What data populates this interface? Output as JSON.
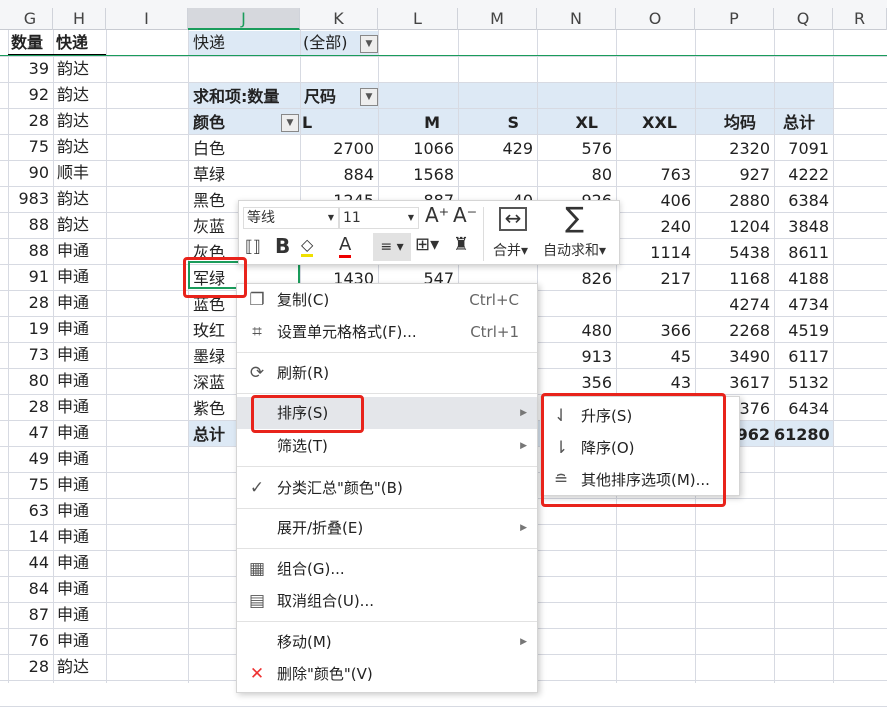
{
  "columns": [
    "G",
    "H",
    "I",
    "J",
    "K",
    "L",
    "M",
    "N",
    "O",
    "P",
    "Q",
    "R"
  ],
  "selected_column": "J",
  "source_headers": {
    "qty": "数量",
    "courier": "快递"
  },
  "source_rows": [
    [
      "39",
      "韵达"
    ],
    [
      "92",
      "韵达"
    ],
    [
      "28",
      "韵达"
    ],
    [
      "75",
      "韵达"
    ],
    [
      "90",
      "顺丰"
    ],
    [
      "983",
      "韵达"
    ],
    [
      "88",
      "韵达"
    ],
    [
      "88",
      "申通"
    ],
    [
      "91",
      "申通"
    ],
    [
      "28",
      "申通"
    ],
    [
      "19",
      "申通"
    ],
    [
      "73",
      "申通"
    ],
    [
      "80",
      "申通"
    ],
    [
      "28",
      "申通"
    ],
    [
      "47",
      "申通"
    ],
    [
      "49",
      "申通"
    ],
    [
      "75",
      "申通"
    ],
    [
      "63",
      "申通"
    ],
    [
      "14",
      "申通"
    ],
    [
      "44",
      "申通"
    ],
    [
      "84",
      "申通"
    ],
    [
      "87",
      "申通"
    ],
    [
      "76",
      "申通"
    ],
    [
      "28",
      "韵达"
    ]
  ],
  "pivot": {
    "filter_label": "快递",
    "filter_value": "(全部)",
    "value_label": "求和项:数量",
    "column_field": "尺码",
    "row_field": "颜色",
    "col_headers": [
      "L",
      "M",
      "S",
      "XL",
      "XXL",
      "均码",
      "总计"
    ],
    "rows": [
      {
        "label": "白色",
        "values": [
          "2700",
          "1066",
          "429",
          "576",
          "",
          "2320",
          "7091"
        ]
      },
      {
        "label": "草绿",
        "values": [
          "884",
          "1568",
          "",
          "80",
          "763",
          "927",
          "4222"
        ]
      },
      {
        "label": "黑色",
        "values": [
          "1245",
          "887",
          "40",
          "926",
          "406",
          "2880",
          "6384"
        ]
      },
      {
        "label": "灰蓝",
        "values": [
          "",
          "",
          "",
          "",
          "240",
          "1204",
          "3848"
        ]
      },
      {
        "label": "灰色",
        "values": [
          "",
          "",
          "",
          "",
          "1114",
          "5438",
          "8611"
        ]
      },
      {
        "label": "军绿",
        "values": [
          "1430",
          "547",
          "",
          "826",
          "217",
          "1168",
          "4188"
        ]
      },
      {
        "label": "蓝色",
        "values": [
          "",
          "",
          "",
          "",
          "",
          "4274",
          "4734"
        ]
      },
      {
        "label": "玫红",
        "values": [
          "",
          "",
          "",
          "480",
          "366",
          "2268",
          "4519"
        ]
      },
      {
        "label": "墨绿",
        "values": [
          "",
          "",
          "",
          "913",
          "45",
          "3490",
          "6117"
        ]
      },
      {
        "label": "深蓝",
        "values": [
          "",
          "",
          "",
          "356",
          "43",
          "3617",
          "5132"
        ]
      },
      {
        "label": "紫色",
        "values": [
          "",
          "",
          "",
          "",
          "",
          "2376",
          "6434"
        ]
      }
    ],
    "total": {
      "label": "总计",
      "values": [
        "",
        "",
        "",
        "",
        "",
        "962",
        "61280"
      ]
    }
  },
  "toolbar": {
    "font": "等线",
    "size": "11",
    "merge": "合并",
    "autosum": "自动求和"
  },
  "menu": {
    "copy": "复制(C)",
    "copy_sc": "Ctrl+C",
    "format": "设置单元格格式(F)...",
    "format_sc": "Ctrl+1",
    "refresh": "刷新(R)",
    "sort": "排序(S)",
    "filter": "筛选(T)",
    "subtotal": "分类汇总\"颜色\"(B)",
    "expand": "展开/折叠(E)",
    "group": "组合(G)...",
    "ungroup": "取消组合(U)...",
    "move": "移动(M)",
    "remove": "删除\"颜色\"(V)"
  },
  "submenu": {
    "asc": "升序(S)",
    "desc": "降序(O)",
    "more": "其他排序选项(M)..."
  },
  "colors": {
    "accent": "#1a9c5b",
    "highlight": "#e8231b",
    "pivot_bg": "#dde9f5"
  }
}
